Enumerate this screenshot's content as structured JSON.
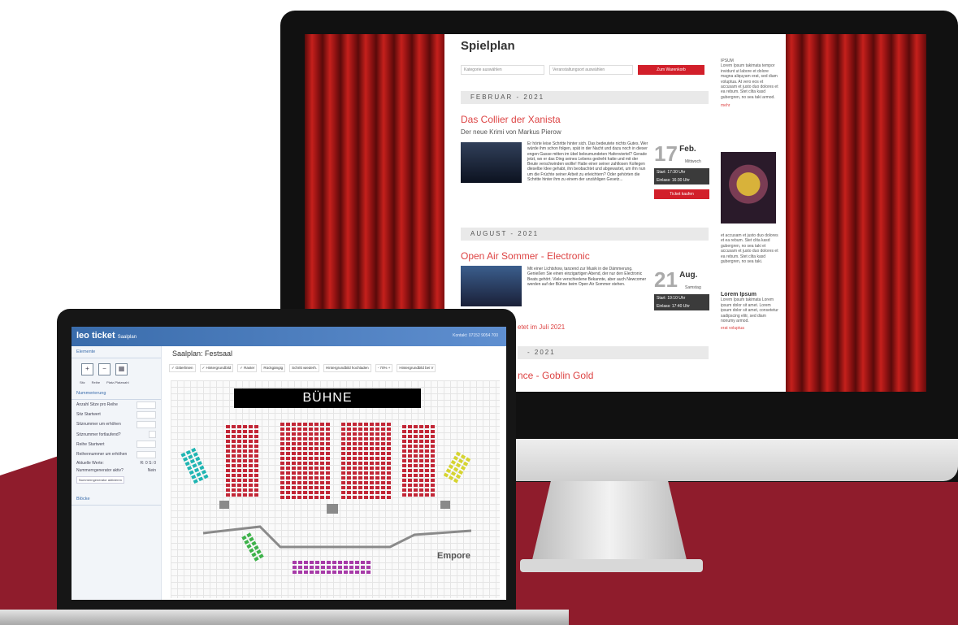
{
  "website": {
    "title": "Spielplan",
    "filters": {
      "category_placeholder": "Kategorie auswählen",
      "venue_placeholder": "Veranstaltungsort auswählen",
      "cart_button": "Zum Warenkorb"
    },
    "months": [
      "FEBRUAR - 2021",
      "AUGUST - 2021",
      "- 2021"
    ],
    "events": [
      {
        "title": "Das Collier der Xanista",
        "subtitle": "Der neue Krimi von Markus Pierow",
        "description": "Er hörte leise Schritte hinter sich. Das bedeutete nichts Gutes. Wer würde ihm schon folgen, spät in der Nacht und dazu noch in dieser engen Gasse mitten im übel beleumundeten Hafenviertel? Gerade jetzt, wo er das Ding seines Lebens gedreht hatte und mit der Beute verschwinden wollte! Hatte einer seiner zahllosen Kollegen dieselbe Idee gehabt, ihn beobachtet und abgewartet, um ihn nun um die Früchte seiner Arbeit zu erleichtern? Oder gehörten die Schritte hinter ihm zu einem der unzähligen Gesetz...",
        "day": "17",
        "month": "Feb.",
        "weekday": "Mittwoch",
        "start": "Start: 17:30 Uhr",
        "entry": "Einlass: 16:30 Uhr",
        "ticket_button": "Ticket kaufen"
      },
      {
        "title": "Open Air Sommer - Electronic",
        "subtitle": "",
        "description": "Mit einer Lichtshow, tanzend zur Musik in die Dämmerung. Genießen Sie einen einzigartigen Abend, der nur den Electronic Beats gehört. Viele verschiedene Bekannte, aber auch Newcomer werden auf der Bühne beim Open Air Sommer stehen.",
        "day": "21",
        "month": "Aug.",
        "weekday": "Samstag",
        "start": "Start: 19:10 Uhr",
        "entry": "Einlass: 17:40 Uhr",
        "ticket_button": ""
      }
    ],
    "postponed_note": "etet im Juli 2021",
    "third_event_title": "nce - Goblin Gold",
    "sidebar": [
      {
        "heading": "IPSUM",
        "text": "Lorem Ipsum takimata tempor invidunt ut labore et dolore magna aliquyam erat, sed diam voluptua. At vero eos et accusam et justo duo dolores et ea rebum. Stet clita kasd gubergren, no sea taki armod.",
        "link": "mehr"
      },
      {
        "heading": "",
        "text": "et accusam et justo duo dolores et ea rebum. Stet clita kasd gubergren, no sea taki et accusam et justo duo dolores et ea rebum. Stet clita kasd gubergren, no sea taki.",
        "link": ""
      },
      {
        "heading": "Lorem Ipsum",
        "text": "Lorem Ipsum takimata Lorem ipsum dolor sit amet. Lorem ipsum dolor sit amet, consetetur sadipscing elitr, sed diam nonumy armod.",
        "link": "erat   voluptua"
      }
    ]
  },
  "app": {
    "logo": "leo ticket",
    "logo_suffix": "Saalplan",
    "contact": "Kontakt: 07152 9054 700",
    "sidebar": {
      "section_elements": "Elemente",
      "tools": [
        "Sitz",
        "Reihe",
        "Platz-Platzwahl"
      ],
      "section_numbering": "Nummerierung",
      "fields": [
        "Anzahl Sitze pro Reihe",
        "Sitz Startwert",
        "Sitznummer um erhöhen",
        "Sitznummer fortlaufend?",
        "Reihe Startwert",
        "Reihennummer um erhöhen"
      ],
      "current_values_label": "Aktuelle Werte:",
      "current_values": "R: 0 S: 0",
      "generator_label": "Nummerngenerator aktiv?",
      "generator_value": "Nein",
      "generator_button": "Nummerngenerator aktivieren",
      "section_blocks": "Blöcke"
    },
    "page_title": "Saalplan: Festsaal",
    "toolbar": [
      "✓ Gitterlinien",
      "✓ Hintergrundbild",
      "✓ Raster",
      "Rückgängig",
      "Schritt wiederh.",
      "Hintergrundbild hochladen",
      "- 70% +",
      "Hintergrundbild bei V"
    ],
    "stage_label": "BÜHNE",
    "balcony_label": "Empore",
    "colors": {
      "main_seats": "#c22636",
      "teal": "#1fb5b2",
      "yellow": "#d6d430",
      "green": "#3db24a",
      "purple": "#a73aa8"
    }
  }
}
